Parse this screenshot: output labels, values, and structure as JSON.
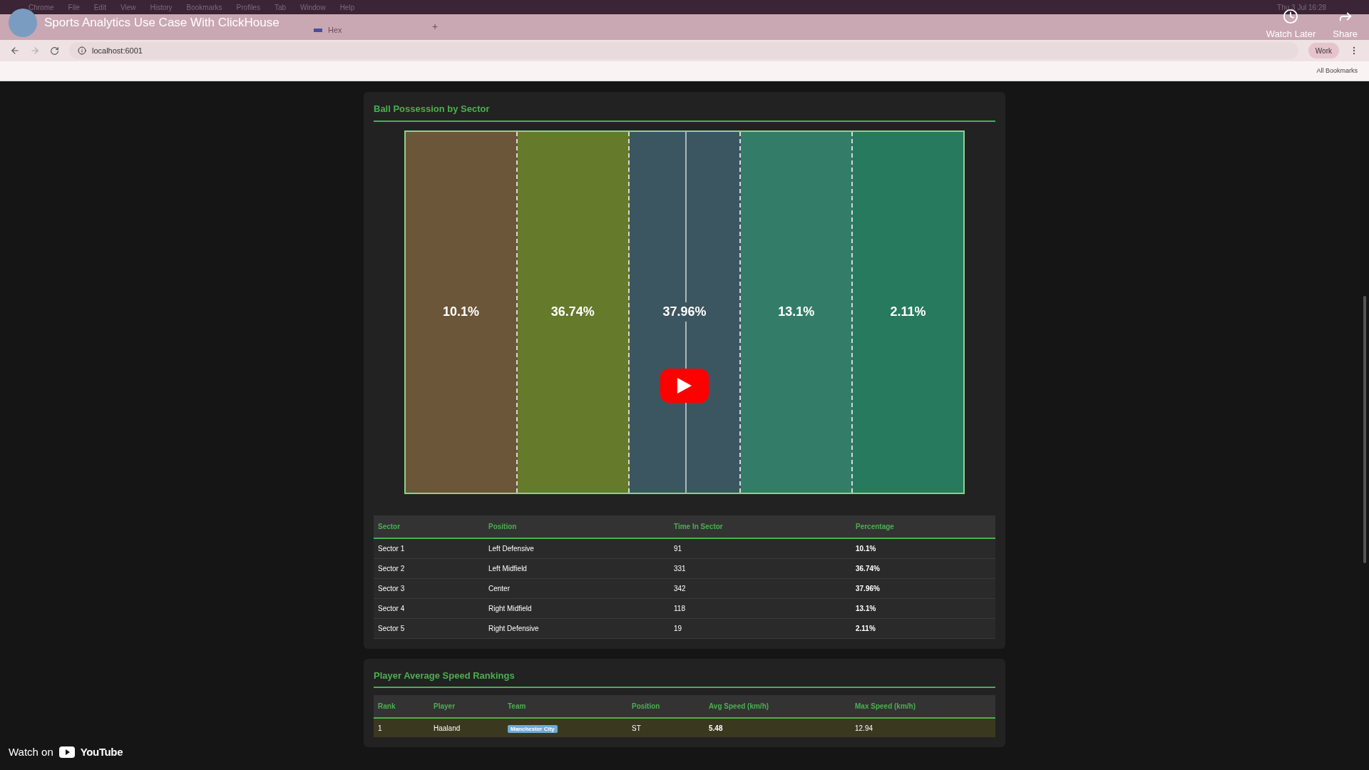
{
  "menu_bar": {
    "items": [
      "Chrome",
      "File",
      "Edit",
      "View",
      "History",
      "Bookmarks",
      "Profiles",
      "Tab",
      "Window",
      "Help"
    ],
    "clock": "Thu 3 Jul 16:28"
  },
  "video_overlay": {
    "title": "Sports Analytics Use Case With ClickHouse",
    "actions": [
      "Watch Later",
      "Share"
    ],
    "watch_on": "Watch on",
    "brand": "YouTube"
  },
  "browser": {
    "tabs": [
      {
        "label": "Hex",
        "selected": false
      }
    ],
    "new_tab": "+",
    "address": "localhost:6001",
    "profile": "Work",
    "bookmarks": "All Bookmarks"
  },
  "possession": {
    "title": "Ball Possession by Sector",
    "sectors": [
      {
        "label": "10.1%",
        "color": "#6b5639"
      },
      {
        "label": "36.74%",
        "color": "#667a2b"
      },
      {
        "label": "37.96%",
        "color": "#3c5661"
      },
      {
        "label": "13.1%",
        "color": "#337d68"
      },
      {
        "label": "2.11%",
        "color": "#277a5d"
      }
    ],
    "columns": [
      "Sector",
      "Position",
      "Time In Sector",
      "Percentage"
    ],
    "rows": [
      [
        "Sector 1",
        "Left Defensive",
        "91",
        "10.1%"
      ],
      [
        "Sector 2",
        "Left Midfield",
        "331",
        "36.74%"
      ],
      [
        "Sector 3",
        "Center",
        "342",
        "37.96%"
      ],
      [
        "Sector 4",
        "Right Midfield",
        "118",
        "13.1%"
      ],
      [
        "Sector 5",
        "Right Defensive",
        "19",
        "2.11%"
      ]
    ]
  },
  "speed": {
    "title": "Player Average Speed Rankings",
    "columns": [
      "Rank",
      "Player",
      "Team",
      "Position",
      "Avg Speed (km/h)",
      "Max Speed (km/h)"
    ],
    "rows": [
      [
        "1",
        "Haaland",
        "Manchester City",
        "ST",
        "5.48",
        "12.94"
      ]
    ]
  }
}
